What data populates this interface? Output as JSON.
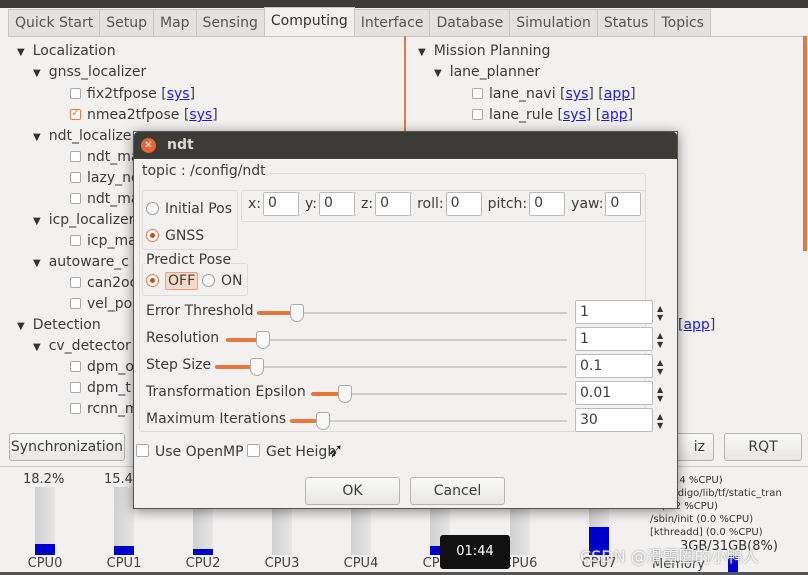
{
  "tabs": [
    "Quick Start",
    "Setup",
    "Map",
    "Sensing",
    "Computing",
    "Interface",
    "Database",
    "Simulation",
    "Status",
    "Topics"
  ],
  "active_tab": "Computing",
  "left_tree": {
    "localization": "Localization",
    "gnss": "gnss_localizer",
    "fix2tfpose": "fix2tfpose",
    "nmea2tfpose": "nmea2tfpose",
    "sys": "sys",
    "ndt": "ndt_localize",
    "ndt_m": "ndt_ma",
    "lazy": "lazy_nd",
    "ndt_m2": "ndt_ma",
    "icp": "icp_localizer",
    "icp_m": "icp_ma",
    "autoware": "autoware_c",
    "can2": "can2oc",
    "vel": "vel_po",
    "detection": "Detection",
    "cv": "cv_detector",
    "dpm_o": "dpm_o",
    "dpm_t": "dpm_t",
    "rcnn": "rcnn_m"
  },
  "right_tree": {
    "mission": "Mission Planning",
    "lane_planner": "lane_planner",
    "lane_navi": "lane_navi",
    "lane_rule": "lane_rule",
    "sys": "sys",
    "app": "app"
  },
  "buttons": {
    "sync": "Synchronization",
    "viz": "iz",
    "rqt": "RQT"
  },
  "cpus": [
    {
      "label": "CPU0",
      "pct": "18.2%",
      "fill": 18.2
    },
    {
      "label": "CPU1",
      "pct": "15.4",
      "fill": 15.4
    },
    {
      "label": "CPU2",
      "fill": 8
    },
    {
      "label": "CPU3",
      "fill": 0
    },
    {
      "label": "CPU4",
      "fill": 0
    },
    {
      "label": "CPU5",
      "fill": 15
    },
    {
      "label": "CPU6",
      "fill": 0
    },
    {
      "label": "CPU7",
      "fill": 45
    }
  ],
  "processes": [
    "n (18.4 %CPU)",
    "ros/indigo/lib/tf/static_tran",
    "rt (9.2 %CPU)",
    "/sbin/init (0.0 %CPU)",
    "[kthreadd] (0.0 %CPU)"
  ],
  "memory": {
    "label": "Memory",
    "value": "3GB/31GB(8%)"
  },
  "timer": "01:44",
  "watermark": "CSDN @滑雪圈的小鸭人",
  "dialog": {
    "title": "ndt",
    "topic": "topic : /config/ndt",
    "initial_pos": "Initial Pos",
    "gnss": "GNSS",
    "selected": "GNSS",
    "pose_fields": [
      {
        "label": "x:",
        "value": "0"
      },
      {
        "label": "y:",
        "value": "0"
      },
      {
        "label": "z:",
        "value": "0"
      },
      {
        "label": "roll:",
        "value": "0"
      },
      {
        "label": "pitch:",
        "value": "0"
      },
      {
        "label": "yaw:",
        "value": "0"
      }
    ],
    "predict_pose": "Predict Pose",
    "off": "OFF",
    "on": "ON",
    "predict_selected": "OFF",
    "sliders": [
      {
        "label": "Error Threshold",
        "value": "1",
        "level": 0.12
      },
      {
        "label": "Resolution",
        "value": "1",
        "level": 0.1
      },
      {
        "label": "Step Size",
        "value": "0.1",
        "level": 0.11
      },
      {
        "label": "Transformation Epsilon",
        "value": "0.01",
        "level": 0.12
      },
      {
        "label": "Maximum Iterations",
        "value": "30",
        "level": 0.11
      }
    ],
    "use_openmp": "Use OpenMP",
    "get_height": "Get Heigh",
    "ok": "OK",
    "cancel": "Cancel"
  },
  "colors": {
    "accent": "#e8773c",
    "titlebar": "#3c3b37",
    "cpu_fill": "#0000cc",
    "link": "#1a1aee"
  }
}
